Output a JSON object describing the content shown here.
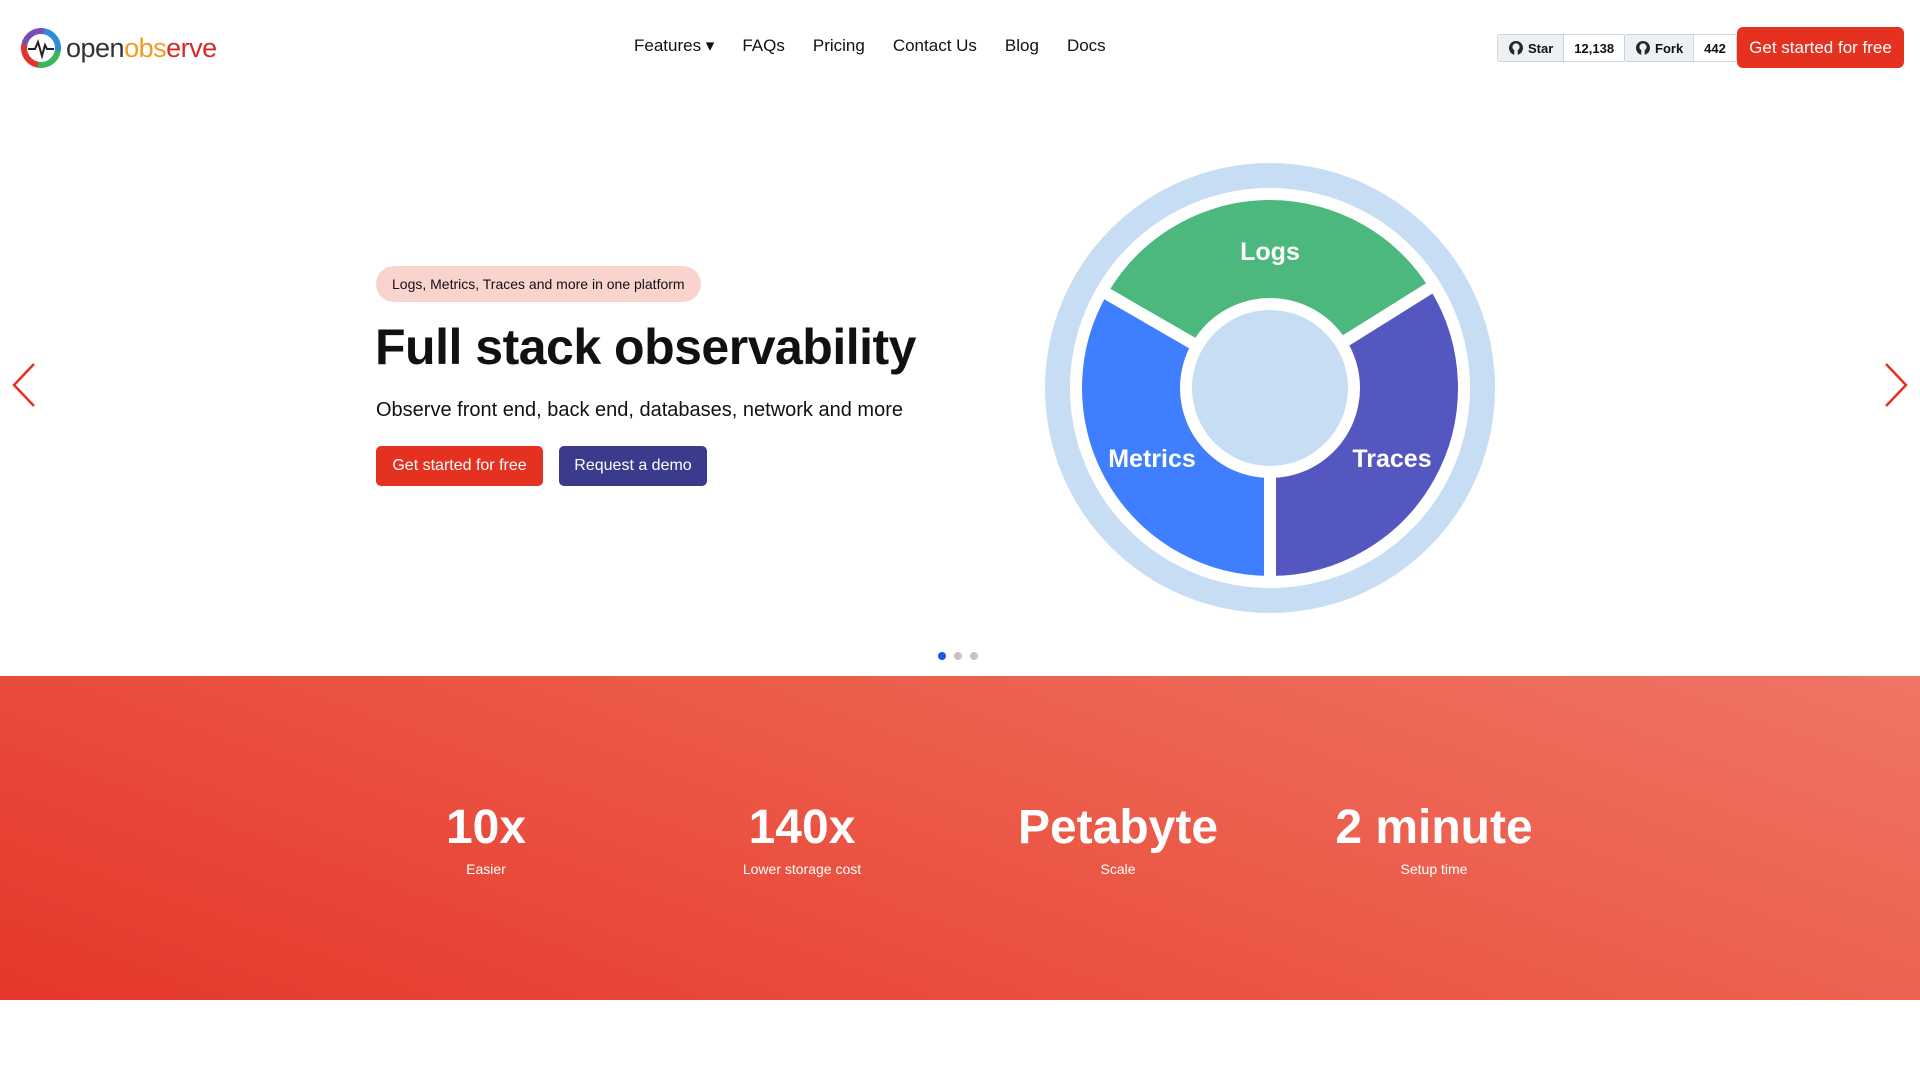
{
  "header": {
    "logo": {
      "part1": "open",
      "part2": "obs",
      "part3": "erve"
    },
    "nav": [
      "Features ▾",
      "FAQs",
      "Pricing",
      "Contact Us",
      "Blog",
      "Docs"
    ],
    "github": {
      "star_label": "Star",
      "star_count": "12,138",
      "fork_label": "Fork",
      "fork_count": "442"
    },
    "cta": "Get started for free"
  },
  "hero": {
    "badge": "Logs, Metrics, Traces and more in one platform",
    "title": "Full stack observability",
    "subtitle": "Observe front end, back end, databases, network and more",
    "primary_button": "Get started for free",
    "secondary_button": "Request a demo",
    "diagram": {
      "segments": [
        {
          "label": "Logs",
          "color": "#4cb87e"
        },
        {
          "label": "Traces",
          "color": "#5457c0"
        },
        {
          "label": "Metrics",
          "color": "#3f7efe"
        }
      ],
      "ring_color": "#c6ddf3"
    },
    "carousel": {
      "slides": 3,
      "active": 1
    }
  },
  "stats": [
    {
      "value": "10x",
      "label": "Easier"
    },
    {
      "value": "140x",
      "label": "Lower storage cost"
    },
    {
      "value": "Petabyte",
      "label": "Scale"
    },
    {
      "value": "2 minute",
      "label": "Setup time"
    }
  ],
  "colors": {
    "brand_red": "#e5311f",
    "demo_blue": "#3a3b8c",
    "dot_active": "#1a56e8"
  }
}
